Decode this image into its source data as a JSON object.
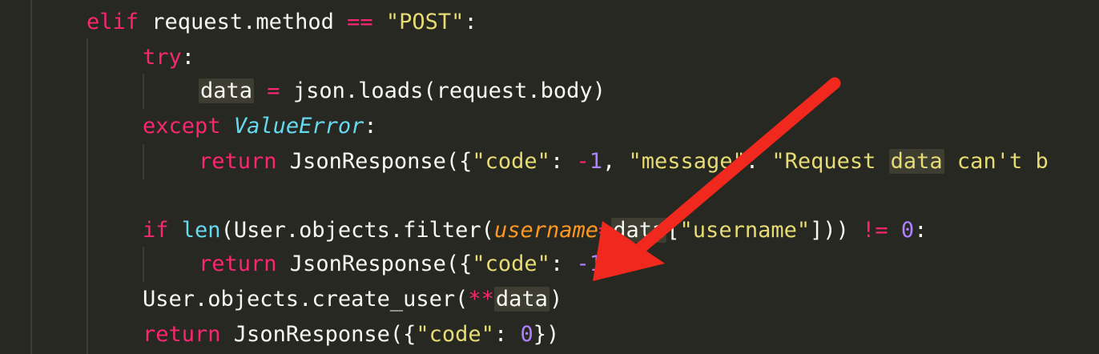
{
  "editor": {
    "theme_colors": {
      "background": "#272822",
      "keyword": "#f92672",
      "string": "#e6db74",
      "number": "#ae81ff",
      "class": "#66d9ef",
      "param": "#fd971f",
      "annotation_arrow": "#f0281e"
    },
    "lines": [
      {
        "tokens": {
          "t1": "elif",
          "t2": " request.method ",
          "t3": "==",
          "t4": " ",
          "t5": "\"POST\"",
          "t6": ":"
        }
      },
      {
        "tokens": {
          "t1": "try",
          "t2": ":"
        }
      },
      {
        "tokens": {
          "t1": "data",
          "t2": " ",
          "t3": "=",
          "t4": " json.loads(request.body)"
        }
      },
      {
        "tokens": {
          "t1": "except",
          "t2": " ",
          "t3": "ValueError",
          "t4": ":"
        }
      },
      {
        "tokens": {
          "t1": "return",
          "t2": " JsonResponse({",
          "t3": "\"code\"",
          "t4": ": ",
          "t5": "-",
          "t6": "1",
          "t7": ", ",
          "t8": "\"message\"",
          "t9": ": ",
          "t10": "\"Request ",
          "t11": "data",
          "t12": " can't b"
        }
      },
      {
        "tokens": {}
      },
      {
        "tokens": {
          "t1": "if",
          "t2": " ",
          "t3": "len",
          "t4": "(User.objects.filter(",
          "t5": "username",
          "t6": "=",
          "t7": "data",
          "t8": "[",
          "t9": "\"username\"",
          "t10": "])) ",
          "t11": "!=",
          "t12": " ",
          "t13": "0",
          "t14": ":"
        }
      },
      {
        "tokens": {
          "t1": "return",
          "t2": " JsonResponse({",
          "t3": "\"code\"",
          "t4": ": ",
          "t5": "-1"
        }
      },
      {
        "tokens": {
          "t1": "User.objects.create_user(",
          "t2": "**",
          "t3": "data",
          "t4": ")"
        }
      },
      {
        "tokens": {
          "t1": "return",
          "t2": " JsonResponse({",
          "t3": "\"code\"",
          "t4": ": ",
          "t5": "0",
          "t6": "})"
        }
      }
    ]
  }
}
